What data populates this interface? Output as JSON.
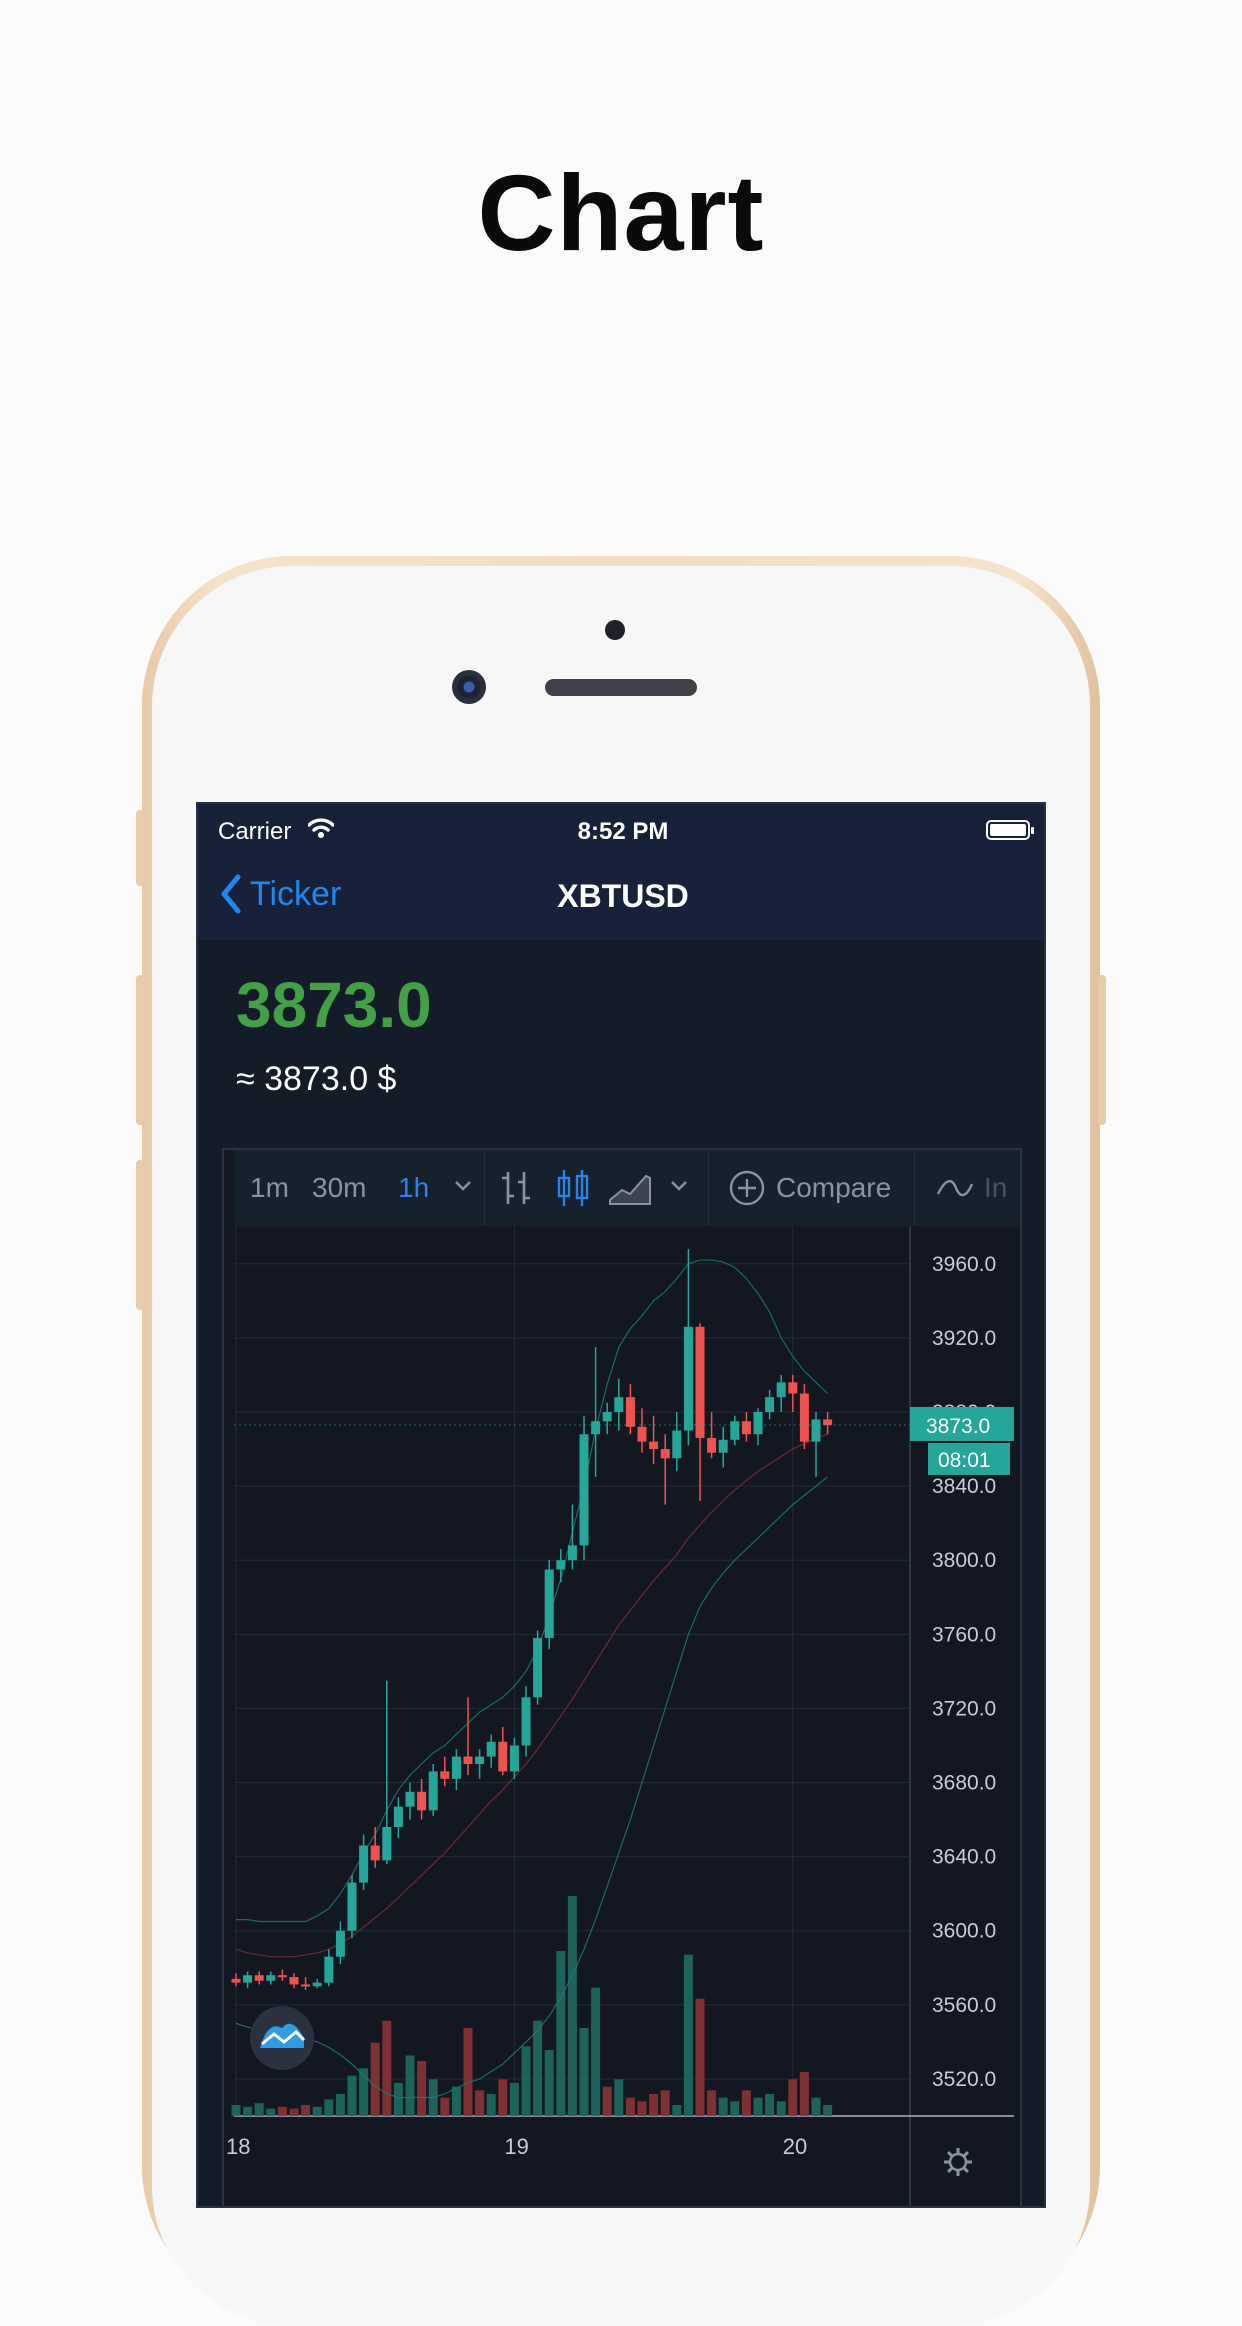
{
  "headline": "Chart",
  "status_bar": {
    "carrier": "Carrier",
    "time": "8:52 PM"
  },
  "nav": {
    "back_label": "Ticker",
    "title": "XBTUSD"
  },
  "price": {
    "last": "3873.0",
    "approx": "≈ 3873.0 $"
  },
  "toolbar": {
    "intervals": [
      "1m",
      "30m",
      "1h"
    ],
    "active_interval": "1h",
    "compare_label": "Compare",
    "indicators_label": "In"
  },
  "colors": {
    "up": "#26a69a",
    "down": "#ef5350",
    "price_text": "#43a047",
    "link": "#1e88f0",
    "background": "#131722"
  },
  "icons": [
    "wifi-icon",
    "battery-icon",
    "chevron-left-icon",
    "chevron-down-icon",
    "bar-chart-icon",
    "candles-icon",
    "area-chart-icon",
    "add-circle-icon",
    "indicators-icon",
    "settings-icon",
    "logo-icon"
  ],
  "chart_data": {
    "type": "candlestick",
    "symbol": "XBTUSD",
    "interval": "1h",
    "y_ticks": [
      "3960.0",
      "3920.0",
      "3880.0",
      "3840.0",
      "3800.0",
      "3760.0",
      "3720.0",
      "3680.0",
      "3640.0",
      "3600.0",
      "3560.0",
      "3520.0"
    ],
    "ylim": [
      3500,
      3975
    ],
    "x_ticks": [
      "18",
      "19",
      "20"
    ],
    "last_price_label": "3873.0",
    "countdown_label": "08:01",
    "ohlc": [
      [
        3574,
        3577,
        3570,
        3572
      ],
      [
        3572,
        3578,
        3569,
        3576
      ],
      [
        3576,
        3578,
        3571,
        3573
      ],
      [
        3573,
        3578,
        3571,
        3576
      ],
      [
        3576,
        3579,
        3573,
        3575
      ],
      [
        3575,
        3577,
        3569,
        3571
      ],
      [
        3571,
        3575,
        3568,
        3570
      ],
      [
        3570,
        3574,
        3569,
        3572
      ],
      [
        3572,
        3590,
        3570,
        3586
      ],
      [
        3586,
        3605,
        3582,
        3600
      ],
      [
        3600,
        3630,
        3596,
        3626
      ],
      [
        3626,
        3652,
        3622,
        3646
      ],
      [
        3646,
        3656,
        3634,
        3638
      ],
      [
        3638,
        3735,
        3636,
        3656
      ],
      [
        3656,
        3672,
        3650,
        3667
      ],
      [
        3667,
        3680,
        3660,
        3675
      ],
      [
        3675,
        3682,
        3660,
        3665
      ],
      [
        3665,
        3690,
        3662,
        3686
      ],
      [
        3686,
        3694,
        3678,
        3682
      ],
      [
        3682,
        3698,
        3676,
        3694
      ],
      [
        3694,
        3726,
        3684,
        3690
      ],
      [
        3690,
        3698,
        3682,
        3694
      ],
      [
        3694,
        3706,
        3688,
        3702
      ],
      [
        3702,
        3710,
        3684,
        3686
      ],
      [
        3686,
        3704,
        3682,
        3700
      ],
      [
        3700,
        3732,
        3694,
        3726
      ],
      [
        3726,
        3762,
        3722,
        3758
      ],
      [
        3758,
        3800,
        3752,
        3795
      ],
      [
        3795,
        3806,
        3788,
        3800
      ],
      [
        3800,
        3830,
        3795,
        3808
      ],
      [
        3808,
        3878,
        3800,
        3868
      ],
      [
        3868,
        3915,
        3845,
        3875
      ],
      [
        3875,
        3885,
        3868,
        3880
      ],
      [
        3880,
        3898,
        3870,
        3888
      ],
      [
        3888,
        3895,
        3868,
        3872
      ],
      [
        3872,
        3882,
        3858,
        3864
      ],
      [
        3864,
        3878,
        3852,
        3860
      ],
      [
        3860,
        3868,
        3830,
        3855
      ],
      [
        3855,
        3880,
        3848,
        3870
      ],
      [
        3870,
        3968,
        3862,
        3926
      ],
      [
        3926,
        3928,
        3832,
        3866
      ],
      [
        3866,
        3880,
        3855,
        3858
      ],
      [
        3858,
        3872,
        3850,
        3865
      ],
      [
        3865,
        3878,
        3862,
        3875
      ],
      [
        3875,
        3880,
        3864,
        3868
      ],
      [
        3868,
        3882,
        3862,
        3880
      ],
      [
        3880,
        3892,
        3876,
        3888
      ],
      [
        3888,
        3900,
        3880,
        3896
      ],
      [
        3896,
        3900,
        3880,
        3890
      ],
      [
        3890,
        3895,
        3860,
        3864
      ],
      [
        3864,
        3880,
        3845,
        3876
      ],
      [
        3876,
        3880,
        3868,
        3873
      ]
    ],
    "volume": [
      6,
      5,
      7,
      4,
      5,
      4,
      6,
      5,
      9,
      12,
      22,
      26,
      40,
      52,
      18,
      33,
      30,
      20,
      10,
      16,
      48,
      14,
      12,
      20,
      18,
      38,
      52,
      36,
      90,
      120,
      48,
      70,
      16,
      20,
      10,
      8,
      12,
      14,
      6,
      88,
      64,
      14,
      10,
      8,
      14,
      10,
      12,
      8,
      20,
      24,
      10,
      6
    ],
    "volume_up": [
      true,
      true,
      true,
      true,
      false,
      false,
      false,
      true,
      true,
      true,
      true,
      true,
      false,
      false,
      true,
      true,
      false,
      true,
      false,
      true,
      false,
      false,
      true,
      false,
      true,
      true,
      true,
      true,
      true,
      true,
      true,
      true,
      false,
      true,
      false,
      false,
      false,
      false,
      true,
      true,
      false,
      false,
      true,
      true,
      false,
      true,
      true,
      true,
      false,
      false,
      true,
      true
    ],
    "ma": [
      3590,
      3588,
      3587,
      3586,
      3586,
      3586,
      3587,
      3588,
      3590,
      3593,
      3597,
      3602,
      3607,
      3612,
      3618,
      3624,
      3630,
      3636,
      3642,
      3649,
      3656,
      3663,
      3670,
      3676,
      3683,
      3690,
      3698,
      3707,
      3716,
      3725,
      3735,
      3745,
      3755,
      3765,
      3773,
      3781,
      3789,
      3796,
      3803,
      3812,
      3819,
      3826,
      3832,
      3838,
      3843,
      3848,
      3852,
      3856,
      3860,
      3863,
      3866,
      3868
    ],
    "bb_upper": [
      3606,
      3606,
      3605,
      3605,
      3605,
      3605,
      3605,
      3608,
      3612,
      3620,
      3630,
      3642,
      3652,
      3665,
      3676,
      3684,
      3690,
      3696,
      3700,
      3706,
      3712,
      3718,
      3722,
      3726,
      3732,
      3740,
      3752,
      3770,
      3790,
      3815,
      3840,
      3870,
      3895,
      3915,
      3925,
      3932,
      3940,
      3945,
      3952,
      3960,
      3962,
      3962,
      3961,
      3958,
      3952,
      3944,
      3934,
      3920,
      3910,
      3902,
      3896,
      3890
    ],
    "bb_lower": [
      3550,
      3548,
      3546,
      3544,
      3543,
      3542,
      3542,
      3540,
      3537,
      3533,
      3528,
      3522,
      3516,
      3512,
      3510,
      3510,
      3510,
      3510,
      3512,
      3515,
      3518,
      3520,
      3524,
      3528,
      3534,
      3540,
      3546,
      3554,
      3564,
      3576,
      3590,
      3606,
      3624,
      3642,
      3660,
      3680,
      3700,
      3720,
      3740,
      3760,
      3775,
      3785,
      3793,
      3800,
      3806,
      3812,
      3818,
      3824,
      3830,
      3835,
      3840,
      3845
    ]
  }
}
